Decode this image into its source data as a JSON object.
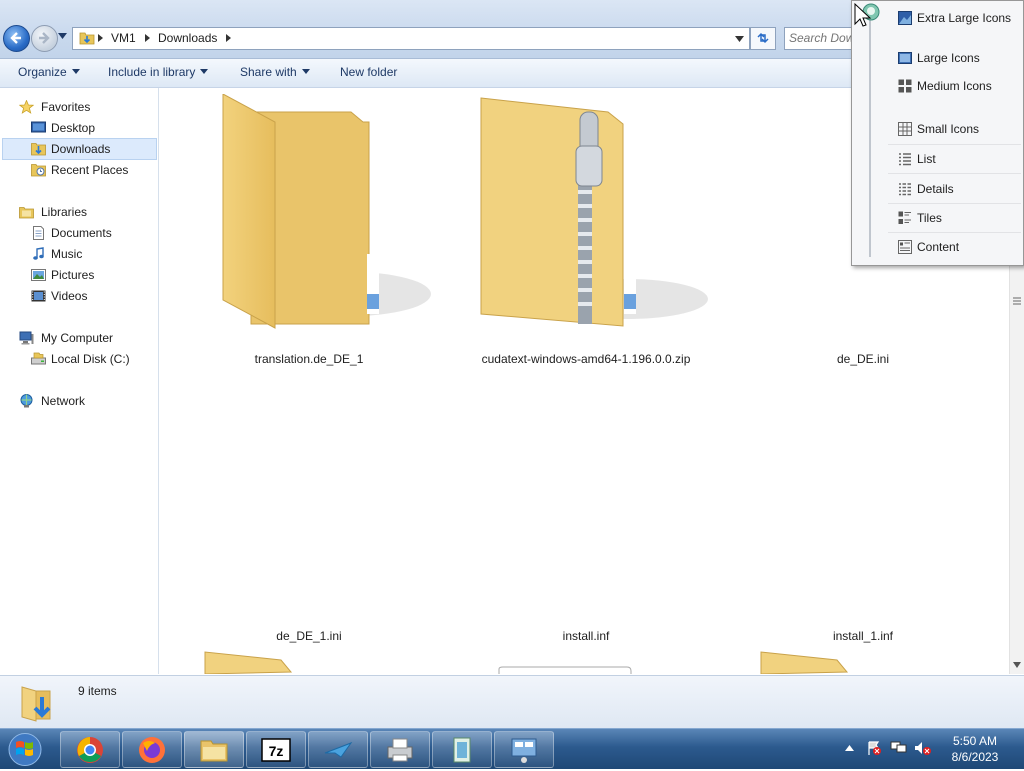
{
  "address": {
    "crumbs": [
      "VM1",
      "Downloads"
    ],
    "search_placeholder": "Search Dow"
  },
  "toolbar": {
    "organize": "Organize",
    "include_in_library": "Include in library",
    "share_with": "Share with",
    "new_folder": "New folder"
  },
  "nav": {
    "favorites": "Favorites",
    "desktop": "Desktop",
    "downloads": "Downloads",
    "recent_places": "Recent Places",
    "libraries": "Libraries",
    "documents": "Documents",
    "music": "Music",
    "pictures": "Pictures",
    "videos": "Videos",
    "my_computer": "My Computer",
    "local_disk": "Local Disk (C:)",
    "network": "Network"
  },
  "files": [
    {
      "name": "translation.de_DE_1",
      "type": "folder"
    },
    {
      "name": "cudatext-windows-amd64-1.196.0.0.zip",
      "type": "zip"
    },
    {
      "name": "de_DE.ini",
      "type": "ini"
    },
    {
      "name": "de_DE_1.ini",
      "type": "ini"
    },
    {
      "name": "install.inf",
      "type": "inf"
    },
    {
      "name": "install_1.inf",
      "type": "inf"
    }
  ],
  "details": {
    "item_count": "9 items"
  },
  "view_menu": {
    "extra_large": "Extra Large Icons",
    "large": "Large Icons",
    "medium": "Medium Icons",
    "small": "Small Icons",
    "list": "List",
    "details": "Details",
    "tiles": "Tiles",
    "content": "Content"
  },
  "clock": {
    "time": "5:50 AM",
    "date": "8/6/2023"
  },
  "colors": {
    "folder": "#f3d47c",
    "taskbar": "#2c5a8e",
    "selection": "#dceafc"
  }
}
